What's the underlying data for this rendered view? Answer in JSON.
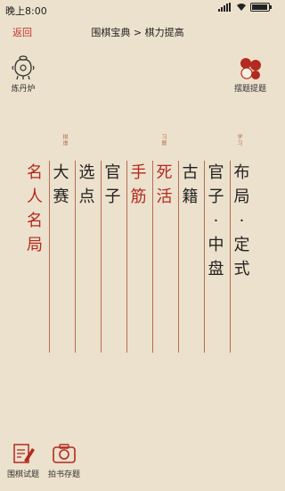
{
  "status": {
    "time": "晚上8:00"
  },
  "nav": {
    "back": "返回",
    "title": "围棋宝典 > 棋力提高"
  },
  "tools": {
    "furnace": "炼丹炉",
    "shuffle": "摆题提题"
  },
  "tags": {
    "qipu": "棋谱",
    "xiti": "习题",
    "xuexi": "学习"
  },
  "columns": [
    {
      "chars": [
        "名",
        "人",
        "名",
        "局"
      ],
      "red": true
    },
    {
      "chars": [
        "大",
        "赛"
      ],
      "red": false
    },
    {
      "chars": [
        "选",
        "点"
      ],
      "red": false
    },
    {
      "chars": [
        "官",
        "子"
      ],
      "red": false
    },
    {
      "chars": [
        "手",
        "筋"
      ],
      "red": true
    },
    {
      "chars": [
        "死",
        "活"
      ],
      "red": true
    },
    {
      "chars": [
        "古",
        "籍"
      ],
      "red": false
    },
    {
      "chars": [
        "官",
        "子",
        "·",
        "中",
        "盘"
      ],
      "red": false
    },
    {
      "chars": [
        "布",
        "局",
        "·",
        "定",
        "式"
      ],
      "red": false
    }
  ],
  "bottom": {
    "test": "围棋试题",
    "photo": "拍书存题"
  },
  "colors": {
    "accent": "#b22a20",
    "background": "#ece1cc",
    "rule": "#b66c55"
  }
}
